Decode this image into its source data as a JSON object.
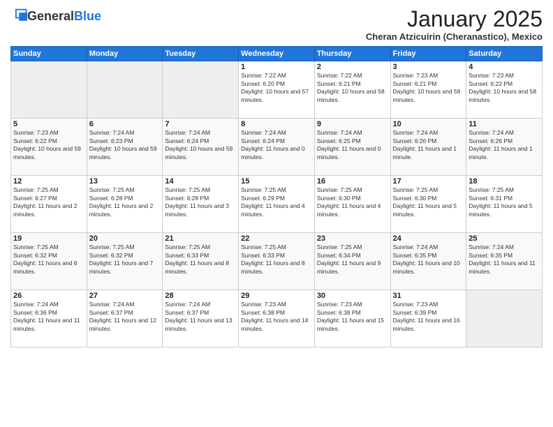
{
  "logo": {
    "general": "General",
    "blue": "Blue"
  },
  "title": "January 2025",
  "location": "Cheran Atzicuirin (Cheranastico), Mexico",
  "days_of_week": [
    "Sunday",
    "Monday",
    "Tuesday",
    "Wednesday",
    "Thursday",
    "Friday",
    "Saturday"
  ],
  "weeks": [
    {
      "days": [
        {
          "num": "",
          "empty": true
        },
        {
          "num": "",
          "empty": true
        },
        {
          "num": "",
          "empty": true
        },
        {
          "num": "1",
          "sunrise": "7:22 AM",
          "sunset": "6:20 PM",
          "daylight": "10 hours and 57 minutes."
        },
        {
          "num": "2",
          "sunrise": "7:22 AM",
          "sunset": "6:21 PM",
          "daylight": "10 hours and 58 minutes."
        },
        {
          "num": "3",
          "sunrise": "7:23 AM",
          "sunset": "6:21 PM",
          "daylight": "10 hours and 58 minutes."
        },
        {
          "num": "4",
          "sunrise": "7:23 AM",
          "sunset": "6:22 PM",
          "daylight": "10 hours and 58 minutes."
        }
      ]
    },
    {
      "days": [
        {
          "num": "5",
          "sunrise": "7:23 AM",
          "sunset": "6:22 PM",
          "daylight": "10 hours and 59 minutes."
        },
        {
          "num": "6",
          "sunrise": "7:24 AM",
          "sunset": "6:23 PM",
          "daylight": "10 hours and 59 minutes."
        },
        {
          "num": "7",
          "sunrise": "7:24 AM",
          "sunset": "6:24 PM",
          "daylight": "10 hours and 59 minutes."
        },
        {
          "num": "8",
          "sunrise": "7:24 AM",
          "sunset": "6:24 PM",
          "daylight": "11 hours and 0 minutes."
        },
        {
          "num": "9",
          "sunrise": "7:24 AM",
          "sunset": "6:25 PM",
          "daylight": "11 hours and 0 minutes."
        },
        {
          "num": "10",
          "sunrise": "7:24 AM",
          "sunset": "6:26 PM",
          "daylight": "11 hours and 1 minute."
        },
        {
          "num": "11",
          "sunrise": "7:24 AM",
          "sunset": "6:26 PM",
          "daylight": "11 hours and 1 minute."
        }
      ]
    },
    {
      "days": [
        {
          "num": "12",
          "sunrise": "7:25 AM",
          "sunset": "6:27 PM",
          "daylight": "11 hours and 2 minutes."
        },
        {
          "num": "13",
          "sunrise": "7:25 AM",
          "sunset": "6:28 PM",
          "daylight": "11 hours and 2 minutes."
        },
        {
          "num": "14",
          "sunrise": "7:25 AM",
          "sunset": "6:28 PM",
          "daylight": "11 hours and 3 minutes."
        },
        {
          "num": "15",
          "sunrise": "7:25 AM",
          "sunset": "6:29 PM",
          "daylight": "11 hours and 4 minutes."
        },
        {
          "num": "16",
          "sunrise": "7:25 AM",
          "sunset": "6:30 PM",
          "daylight": "11 hours and 4 minutes."
        },
        {
          "num": "17",
          "sunrise": "7:25 AM",
          "sunset": "6:30 PM",
          "daylight": "11 hours and 5 minutes."
        },
        {
          "num": "18",
          "sunrise": "7:25 AM",
          "sunset": "6:31 PM",
          "daylight": "11 hours and 5 minutes."
        }
      ]
    },
    {
      "days": [
        {
          "num": "19",
          "sunrise": "7:25 AM",
          "sunset": "6:32 PM",
          "daylight": "11 hours and 6 minutes."
        },
        {
          "num": "20",
          "sunrise": "7:25 AM",
          "sunset": "6:32 PM",
          "daylight": "11 hours and 7 minutes."
        },
        {
          "num": "21",
          "sunrise": "7:25 AM",
          "sunset": "6:33 PM",
          "daylight": "11 hours and 8 minutes."
        },
        {
          "num": "22",
          "sunrise": "7:25 AM",
          "sunset": "6:33 PM",
          "daylight": "11 hours and 8 minutes."
        },
        {
          "num": "23",
          "sunrise": "7:25 AM",
          "sunset": "6:34 PM",
          "daylight": "11 hours and 9 minutes."
        },
        {
          "num": "24",
          "sunrise": "7:24 AM",
          "sunset": "6:35 PM",
          "daylight": "11 hours and 10 minutes."
        },
        {
          "num": "25",
          "sunrise": "7:24 AM",
          "sunset": "6:35 PM",
          "daylight": "11 hours and 11 minutes."
        }
      ]
    },
    {
      "days": [
        {
          "num": "26",
          "sunrise": "7:24 AM",
          "sunset": "6:36 PM",
          "daylight": "11 hours and 11 minutes."
        },
        {
          "num": "27",
          "sunrise": "7:24 AM",
          "sunset": "6:37 PM",
          "daylight": "11 hours and 12 minutes."
        },
        {
          "num": "28",
          "sunrise": "7:24 AM",
          "sunset": "6:37 PM",
          "daylight": "11 hours and 13 minutes."
        },
        {
          "num": "29",
          "sunrise": "7:23 AM",
          "sunset": "6:38 PM",
          "daylight": "11 hours and 14 minutes."
        },
        {
          "num": "30",
          "sunrise": "7:23 AM",
          "sunset": "6:38 PM",
          "daylight": "11 hours and 15 minutes."
        },
        {
          "num": "31",
          "sunrise": "7:23 AM",
          "sunset": "6:39 PM",
          "daylight": "11 hours and 16 minutes."
        },
        {
          "num": "",
          "empty": true
        }
      ]
    }
  ]
}
